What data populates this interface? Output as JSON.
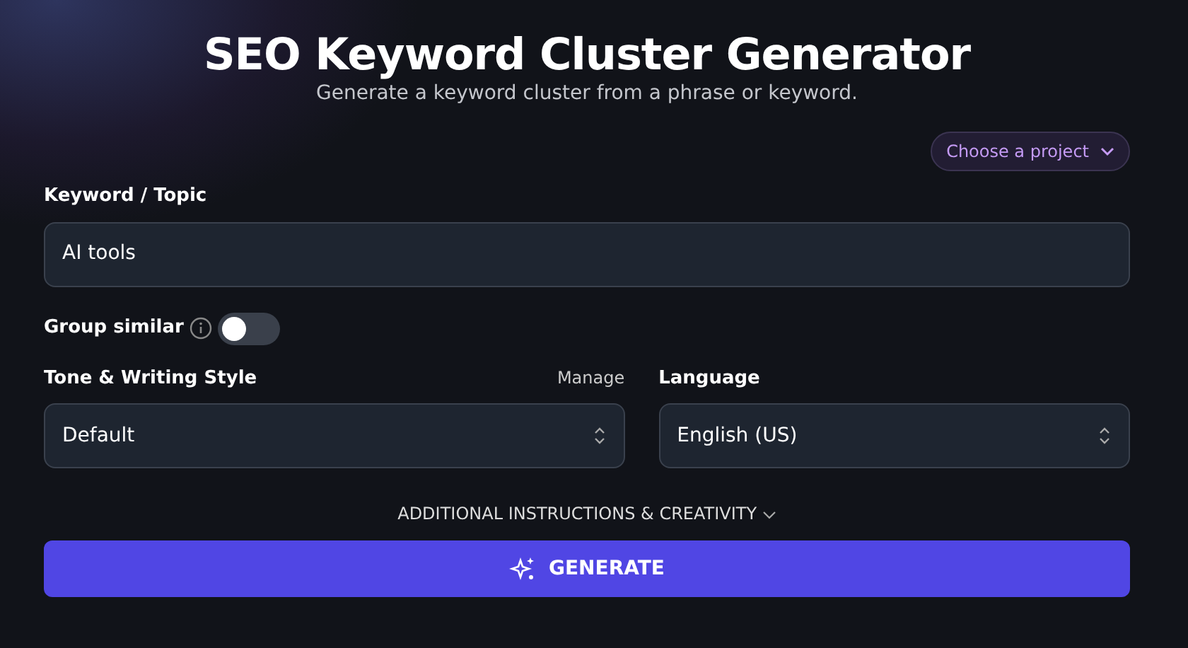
{
  "title": "SEO Keyword Cluster Generator",
  "subtitle": "Generate a keyword cluster from a phrase or keyword.",
  "project_button": {
    "label": "Choose a project"
  },
  "keyword": {
    "label": "Keyword / Topic",
    "value": "AI tools"
  },
  "group_similar": {
    "label": "Group similar",
    "on": false
  },
  "tone": {
    "label": "Tone & Writing Style",
    "link": "Manage",
    "value": "Default"
  },
  "language": {
    "label": "Language",
    "value": "English (US)"
  },
  "additional": {
    "label": "ADDITIONAL INSTRUCTIONS & CREATIVITY",
    "expanded": false
  },
  "generate_button": {
    "label": "GENERATE"
  }
}
